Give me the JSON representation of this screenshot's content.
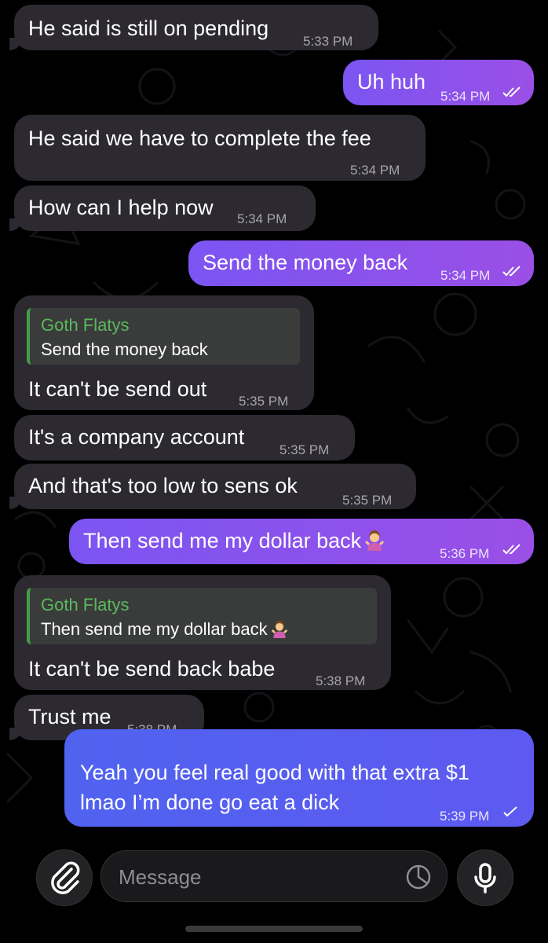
{
  "messages": [
    {
      "dir": "in",
      "text": "He said is still on pending",
      "time": "5:33 PM"
    },
    {
      "dir": "out",
      "text": "Uh huh",
      "time": "5:34 PM",
      "status": "read"
    },
    {
      "dir": "in",
      "text": "He said we have to complete the fee",
      "time": "5:34 PM"
    },
    {
      "dir": "in",
      "text": "How can I help now",
      "time": "5:34 PM"
    },
    {
      "dir": "out",
      "text": "Send the money back",
      "time": "5:34 PM",
      "status": "read"
    },
    {
      "dir": "in",
      "reply_to": {
        "name": "Goth Flatys",
        "text": "Send the money back"
      },
      "text": "It can't be send out",
      "time": "5:35 PM"
    },
    {
      "dir": "in",
      "text": "It's a company account",
      "time": "5:35 PM"
    },
    {
      "dir": "in",
      "text": "And that's too low to sens ok",
      "time": "5:35 PM"
    },
    {
      "dir": "out",
      "text": "Then send me my dollar back",
      "emoji": "woman-shrugging",
      "time": "5:36 PM",
      "status": "read"
    },
    {
      "dir": "in",
      "reply_to": {
        "name": "Goth Flatys",
        "text": "Then send me my dollar back",
        "emoji": "woman-shrugging"
      },
      "text": "It can't be send back babe",
      "time": "5:38 PM"
    },
    {
      "dir": "in",
      "text": "Trust me",
      "time": "5:38 PM"
    },
    {
      "dir": "out",
      "lines": [
        "Yeah you feel real good with that extra $1",
        "lmao I’m done go eat a dick"
      ],
      "time": "5:39 PM",
      "status": "sent"
    }
  ],
  "composer": {
    "placeholder": "Message"
  },
  "icons": [
    "paperclip-icon",
    "sticker-icon",
    "microphone-icon",
    "double-check-icon",
    "single-check-icon",
    "woman-shrugging-emoji"
  ],
  "colors": {
    "background": "#000000",
    "incoming_bubble": "#2c2a30",
    "outgoing_bubble": "#8a52ee",
    "outgoing_bubble_last": "#5560ef",
    "reply_name": "#5cb85c",
    "reply_bar": "#43a047",
    "timestamp": "#a6a5ab"
  }
}
